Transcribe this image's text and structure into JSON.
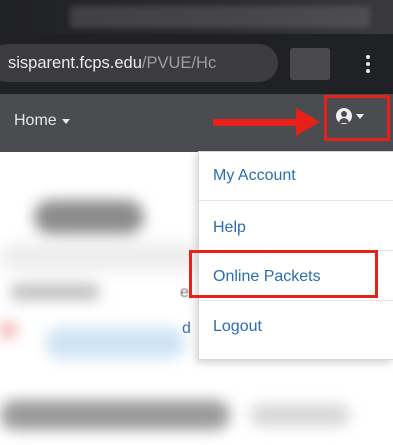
{
  "browser": {
    "url_host": "sisparent.fcps.edu",
    "url_path": "/PVUE/Hc"
  },
  "navbar": {
    "home_label": "Home"
  },
  "user_menu": {
    "items": [
      {
        "label": "My Account"
      },
      {
        "label": "Help"
      },
      {
        "label": "Online Packets"
      },
      {
        "label": "Logout"
      }
    ]
  },
  "background": {
    "edge_glyph_1": "e",
    "edge_glyph_2": "d"
  },
  "colors": {
    "annotation_red": "#e8201a",
    "link_blue": "#2a6db0",
    "navbar_gray": "#4a4c50",
    "browser_dark": "#202124"
  },
  "icons": [
    "user-circle-icon",
    "caret-down-icon",
    "kebab-menu-icon"
  ]
}
